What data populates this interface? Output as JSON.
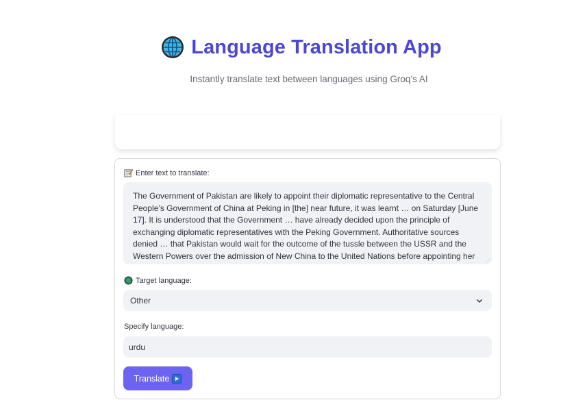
{
  "header": {
    "globe_icon": "globe-icon",
    "title": "Language Translation App",
    "subtitle": "Instantly translate text between languages using Groq’s AI"
  },
  "form": {
    "text_label_icon": "memo-icon",
    "text_label": "Enter text to translate:",
    "text_value": "The Government of Pakistan are likely to appoint their diplomatic representative to the Central People’s Government of China at Peking in [the] near future, it was learnt … on Saturday [June 17]. It is understood that the Government … have already decided upon the principle of exchanging diplomatic representatives with the Peking Government. Authoritative sources denied … that Pakistan would wait for the outcome of the tussle between the USSR and the Western Powers over the admission of New China to the United Nations before appointing her",
    "target_label_icon": "globe-small-icon",
    "target_label": "Target language:",
    "target_value": "Other",
    "specify_label": "Specify language:",
    "specify_value": "urdu",
    "translate_button": "Translate",
    "translate_icon": "play-button-icon"
  },
  "colors": {
    "title": "#4d46d6",
    "button": "#6c63f0",
    "field_bg": "#f0f2f6"
  }
}
